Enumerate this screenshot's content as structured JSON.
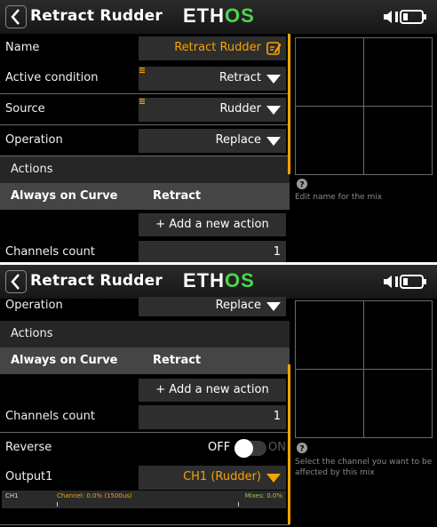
{
  "app": {
    "logo_part1": "ETH",
    "logo_part2": "OS"
  },
  "screen1": {
    "title": "Retract Rudder",
    "name_label": "Name",
    "name_value": "Retract Rudder",
    "active_condition_label": "Active condition",
    "active_condition_value": "Retract",
    "source_label": "Source",
    "source_value": "Rudder",
    "operation_label": "Operation",
    "operation_value": "Replace",
    "actions_label": "Actions",
    "actions_cols": [
      "Always on",
      "Curve",
      "Retract"
    ],
    "add_action_label": "+ Add a new action",
    "channels_count_label": "Channels count",
    "channels_count_value": "1",
    "help_text": "Edit name for the mix"
  },
  "screen2": {
    "title": "Retract Rudder",
    "operation_label": "Operation",
    "operation_value": "Replace",
    "actions_label": "Actions",
    "actions_cols": [
      "Always on",
      "Curve",
      "Retract"
    ],
    "add_action_label": "+ Add a new action",
    "channels_count_label": "Channels count",
    "channels_count_value": "1",
    "reverse_label": "Reverse",
    "reverse_off": "OFF",
    "reverse_on": "ON",
    "output_label": "Output1",
    "output_value": "CH1 (Rudder)",
    "monitor_channel": "CH1",
    "monitor_channel_value": "Channel: 0.0% (1500us)",
    "monitor_mixes": "Mixes: 0.0%",
    "help_text_1": "Select the channel you want to be",
    "help_text_2": "affected by this mix"
  },
  "colors": {
    "accent": "#f5a300",
    "logo_green": "#4cd64c",
    "mix_green": "#8ed04a"
  }
}
